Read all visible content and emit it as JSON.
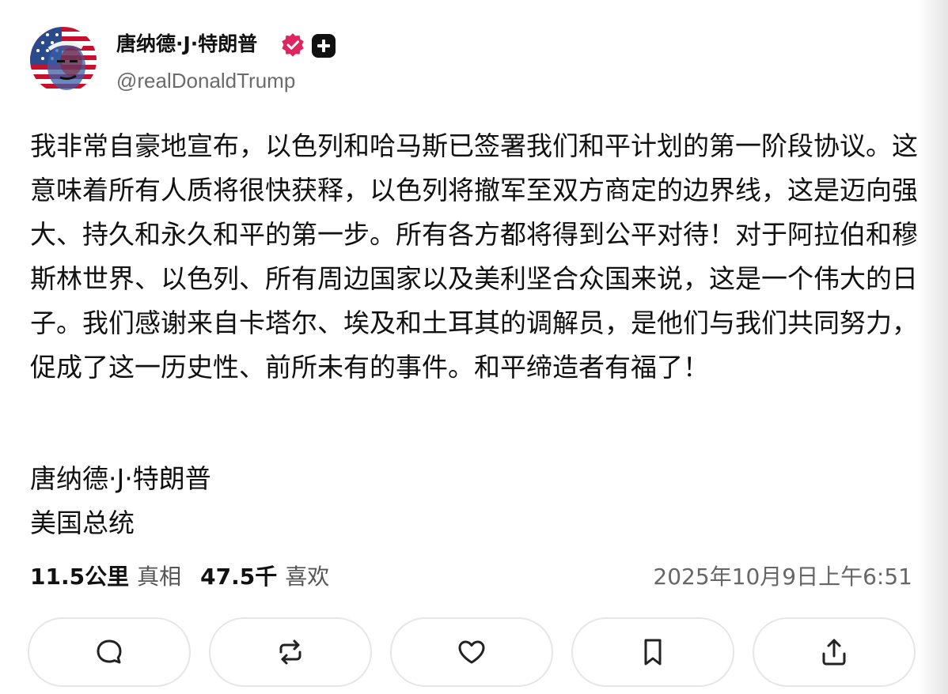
{
  "author": {
    "display_name": "唐纳德·J·特朗普",
    "handle": "@realDonaldTrump",
    "verified_icon": "verified-badge-icon",
    "badge_icon": "plus-badge-icon"
  },
  "post": {
    "text": "我非常自豪地宣布，以色列和哈马斯已签署我们和平计划的第一阶段协议。这意味着所有人质将很快获释，以色列将撤军至双方商定的边界线，这是迈向强大、持久和永久和平的第一步。所有各方都将得到公平对待！对于阿拉伯和穆斯林世界、以色列、所有周边国家以及美利坚合众国来说，这是一个伟大的日子。我们感谢来自卡塔尔、埃及和土耳其的调解员，是他们与我们共同努力，促成了这一历史性、前所未有的事件。和平缔造者有福了！",
    "signature_name": "唐纳德·J·特朗普",
    "signature_title": "美国总统"
  },
  "stats": {
    "truths_count": "11.5公里",
    "truths_label": "真相",
    "likes_count": "47.5千",
    "likes_label": "喜欢"
  },
  "timestamp": "2025年10月9日上午6:51",
  "actions": [
    "reply-icon",
    "retruth-icon",
    "like-icon",
    "bookmark-icon",
    "share-icon"
  ],
  "colors": {
    "verified": "#e0245e",
    "text": "#111111",
    "muted": "#666666",
    "border": "#e6e6e6"
  }
}
